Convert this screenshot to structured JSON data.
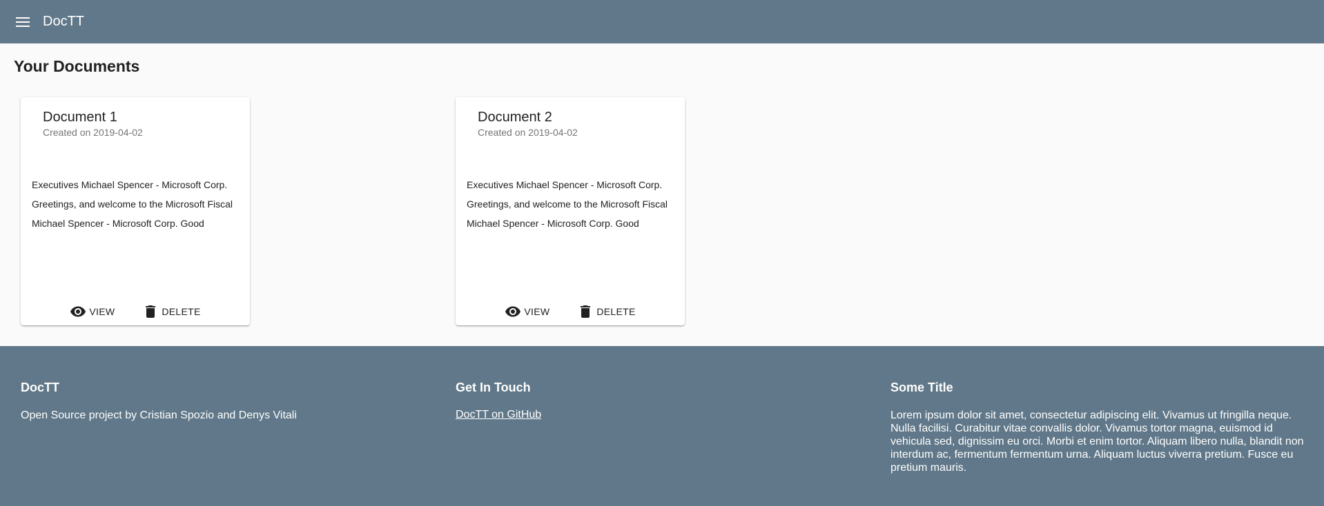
{
  "appbar": {
    "menu_icon": "menu-icon",
    "title": "DocTT"
  },
  "main": {
    "title": "Your Documents",
    "documents": [
      {
        "title": "Document 1",
        "subtitle": "Created on 2019-04-02",
        "excerpt": [
          "Executives Michael Spencer - Microsoft Corp.",
          "Greetings, and welcome to the Microsoft Fiscal",
          "Michael Spencer - Microsoft Corp. Good"
        ],
        "view_label": "VIEW",
        "delete_label": "DELETE"
      },
      {
        "title": "Document 2",
        "subtitle": "Created on 2019-04-02",
        "excerpt": [
          "Executives Michael Spencer - Microsoft Corp.",
          "Greetings, and welcome to the Microsoft Fiscal",
          "Michael Spencer - Microsoft Corp. Good"
        ],
        "view_label": "VIEW",
        "delete_label": "DELETE"
      }
    ]
  },
  "footer": {
    "col1": {
      "heading": "DocTT",
      "text": "Open Source project by Cristian Spozio and Denys Vitali"
    },
    "col2": {
      "heading": "Get In Touch",
      "link": "DocTT on GitHub"
    },
    "col3": {
      "heading": "Some Title",
      "text": "Lorem ipsum dolor sit amet, consectetur adipiscing elit. Vivamus ut fringilla neque. Nulla facilisi. Curabitur vitae convallis dolor. Vivamus tortor magna, euismod id vehicula sed, dignissim eu orci. Morbi et enim tortor. Aliquam libero nulla, blandit non interdum ac, fermentum fermentum urna. Aliquam luctus viverra pretium. Fusce eu pretium mauris."
    }
  },
  "colors": {
    "appbar": "#607889",
    "footer": "#607889",
    "background": "#fafafa",
    "card": "#ffffff"
  }
}
